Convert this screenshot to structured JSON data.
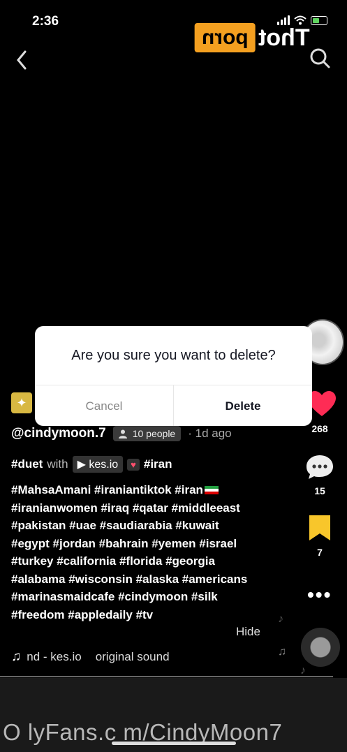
{
  "status_bar": {
    "time": "2:36"
  },
  "watermark": {
    "logo_left": "porn",
    "logo_right": "Thot",
    "bottom_text": "O lyFans.c m/CindyMoon7"
  },
  "dialog": {
    "message": "Are you sure you want to delete?",
    "cancel_label": "Cancel",
    "delete_label": "Delete"
  },
  "actions": {
    "likes": "268",
    "comments": "15",
    "saves": "7"
  },
  "post": {
    "username": "@cindymoon.7",
    "people": "10 people",
    "time_ago": "· 1d ago",
    "duet_tag": "#duet",
    "with_text": "with",
    "duet_source": "kes.io",
    "first_tag": "#iran",
    "hashtag_lines": [
      "#MahsaAmani #iraniantiktok #iran",
      "#iranianwomen #iraq #qatar #middleeast",
      "#pakistan #uae #saudiarabia #kuwait",
      "#egypt #jordan #bahrain #yemen #israel",
      "#turkey #california #florida #georgia",
      "#alabama #wisconsin #alaska #americans",
      "#marinasmaidcafe #cindymoon #silk",
      "#freedom #appledaily #tv"
    ],
    "hide_label": "Hide",
    "sound_left": "nd - kes.io",
    "sound_right": "original sound"
  },
  "icons": [
    "back-icon",
    "search-icon",
    "heart-icon",
    "comment-icon",
    "bookmark-icon",
    "more-icon",
    "music-note-icon"
  ],
  "colors": {
    "like": "#fe2c55",
    "bookmark": "#f8c62b",
    "watermark_orange": "#f4a020"
  }
}
